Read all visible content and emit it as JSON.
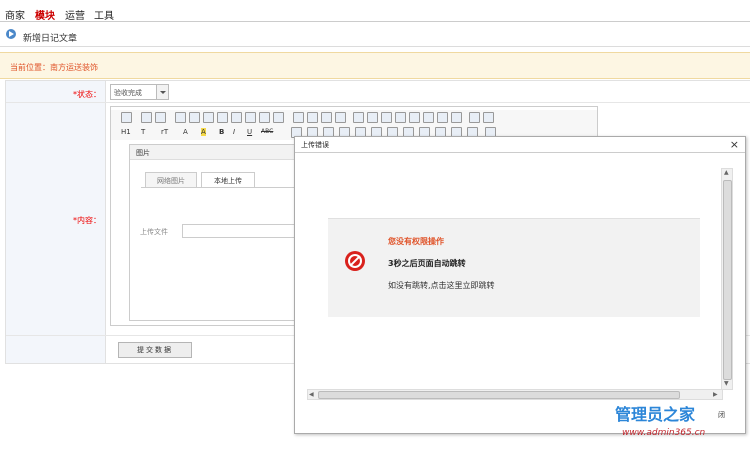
{
  "nav": {
    "items": [
      "商家",
      "模块",
      "运营",
      "工具"
    ],
    "active": "模块"
  },
  "page": {
    "title": "新增日记文章"
  },
  "location": {
    "label": "当前位置：",
    "path": "南方运送装饰"
  },
  "form": {
    "status_label": "*状态：",
    "status_value": "验收完成",
    "content_label": "*内容：",
    "submit_label": "提交数据"
  },
  "editor": {
    "toolbar_text": [
      "H1",
      "T",
      "rT",
      "A",
      "A",
      "B",
      "I",
      "U",
      "ABC"
    ],
    "image_dialog": {
      "title": "图片",
      "tabs": [
        "网络图片",
        "本地上传"
      ],
      "active_tab": "本地上传",
      "upload_label": "上传文件"
    }
  },
  "modal": {
    "title": "上传错误",
    "close_symbol": "×",
    "error_title": "您没有权限操作",
    "redirect_text": "3秒之后页面自动跳转",
    "link_text": "如没有跳转,点击这里立即跳转",
    "peek_button": "闭"
  },
  "watermark": {
    "line1": "管理员之家",
    "line2": "www.admin365.cn"
  },
  "colors": {
    "accent_red": "#c00",
    "error_orange": "#e0542a",
    "link_blue": "#2c86d8"
  }
}
